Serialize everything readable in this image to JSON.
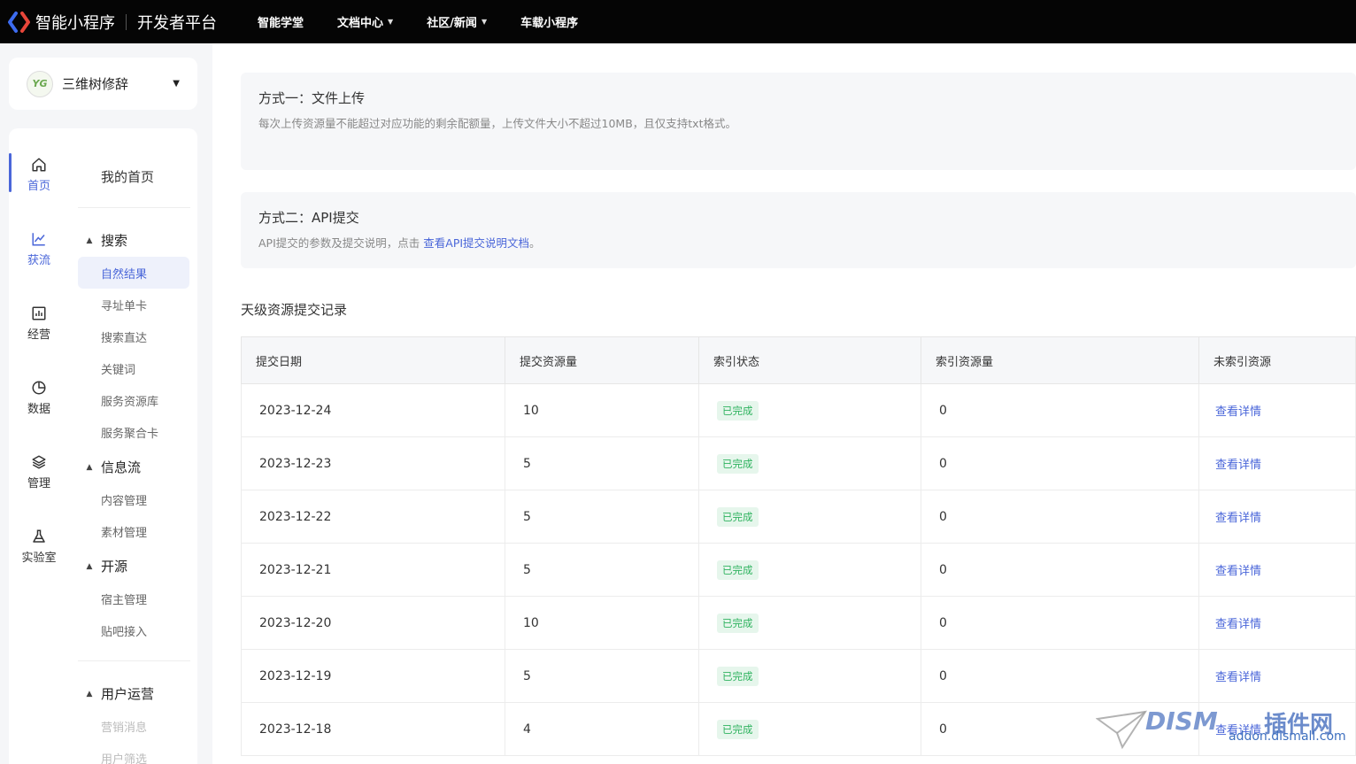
{
  "topbar": {
    "brand": "智能小程序",
    "subtitle": "开发者平台",
    "nav": [
      {
        "label": "智能学堂",
        "has_caret": false
      },
      {
        "label": "文档中心",
        "has_caret": true
      },
      {
        "label": "社区/新闻",
        "has_caret": true
      },
      {
        "label": "车载小程序",
        "has_caret": false
      }
    ]
  },
  "account": {
    "name": "三维树修辞",
    "avatar_text": "YG"
  },
  "rail": [
    {
      "label": "首页",
      "icon": "home-icon"
    },
    {
      "label": "获流",
      "icon": "chart-line-icon"
    },
    {
      "label": "经营",
      "icon": "bar-chart-icon"
    },
    {
      "label": "数据",
      "icon": "pie-chart-icon"
    },
    {
      "label": "管理",
      "icon": "layers-icon"
    },
    {
      "label": "实验室",
      "icon": "flask-icon"
    }
  ],
  "submenu": {
    "home": "我的首页",
    "groups": [
      {
        "label": "搜索",
        "items": [
          "自然结果",
          "寻址单卡",
          "搜索直达",
          "关键词",
          "服务资源库",
          "服务聚合卡"
        ]
      },
      {
        "label": "信息流",
        "items": [
          "内容管理",
          "素材管理"
        ]
      },
      {
        "label": "开源",
        "items": [
          "宿主管理",
          "贴吧接入"
        ]
      },
      {
        "label": "用户运营",
        "items": [
          "营销消息",
          "用户筛选"
        ]
      }
    ]
  },
  "methods": [
    {
      "title": "方式一：文件上传",
      "desc": "每次上传资源量不能超过对应功能的剩余配额量，上传文件大小不超过10MB，且仅支持txt格式。"
    },
    {
      "title": "方式二：API提交",
      "desc_prefix": "API提交的参数及提交说明，点击",
      "link": "查看API提交说明文档",
      "desc_suffix": "。"
    }
  ],
  "records": {
    "title": "天级资源提交记录",
    "columns": [
      "提交日期",
      "提交资源量",
      "索引状态",
      "索引资源量",
      "未索引资源"
    ],
    "rows": [
      {
        "date": "2023-12-24",
        "count": "10",
        "status": "已完成",
        "indexed": "0",
        "action": "查看详情"
      },
      {
        "date": "2023-12-23",
        "count": "5",
        "status": "已完成",
        "indexed": "0",
        "action": "查看详情"
      },
      {
        "date": "2023-12-22",
        "count": "5",
        "status": "已完成",
        "indexed": "0",
        "action": "查看详情"
      },
      {
        "date": "2023-12-21",
        "count": "5",
        "status": "已完成",
        "indexed": "0",
        "action": "查看详情"
      },
      {
        "date": "2023-12-20",
        "count": "10",
        "status": "已完成",
        "indexed": "0",
        "action": "查看详情"
      },
      {
        "date": "2023-12-19",
        "count": "5",
        "status": "已完成",
        "indexed": "0",
        "action": "查看详情"
      },
      {
        "date": "2023-12-18",
        "count": "4",
        "status": "已完成",
        "indexed": "0",
        "action": "查看详情"
      }
    ]
  },
  "watermark": {
    "brand": "DISM",
    "cn": "插件网",
    "url": "addon.dismall.com"
  },
  "colors": {
    "accent": "#4a66d9",
    "topbar": "#050505",
    "success": "#2fb35f"
  }
}
